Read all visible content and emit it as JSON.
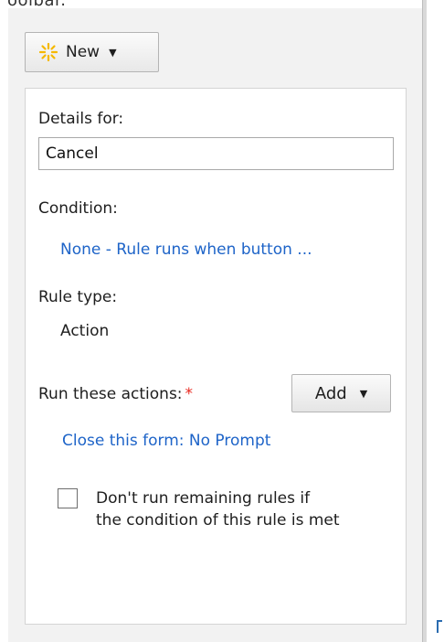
{
  "task_pane": {
    "clipped_text": "oolbar.",
    "new_button": {
      "label": "New",
      "icon": "sparkle-icon"
    },
    "details": {
      "details_label": "Details for:",
      "rule_name_value": "Cancel",
      "condition_label": "Condition:",
      "condition_link": "None - Rule runs when button ...",
      "rule_type_label": "Rule type:",
      "rule_type_value": "Action",
      "actions_label": "Run these actions:",
      "required_marker": "*",
      "add_button_label": "Add",
      "action_link": "Close this form: No Prompt",
      "checkbox_line1": "Don't run remaining rules if",
      "checkbox_line2": "the condition of this rule is met",
      "checkbox_checked": false
    }
  },
  "colors": {
    "link": "#1e64c8",
    "required": "#e8261d",
    "pane_background": "#f2f2f2",
    "sparkle": "#f5b800"
  }
}
